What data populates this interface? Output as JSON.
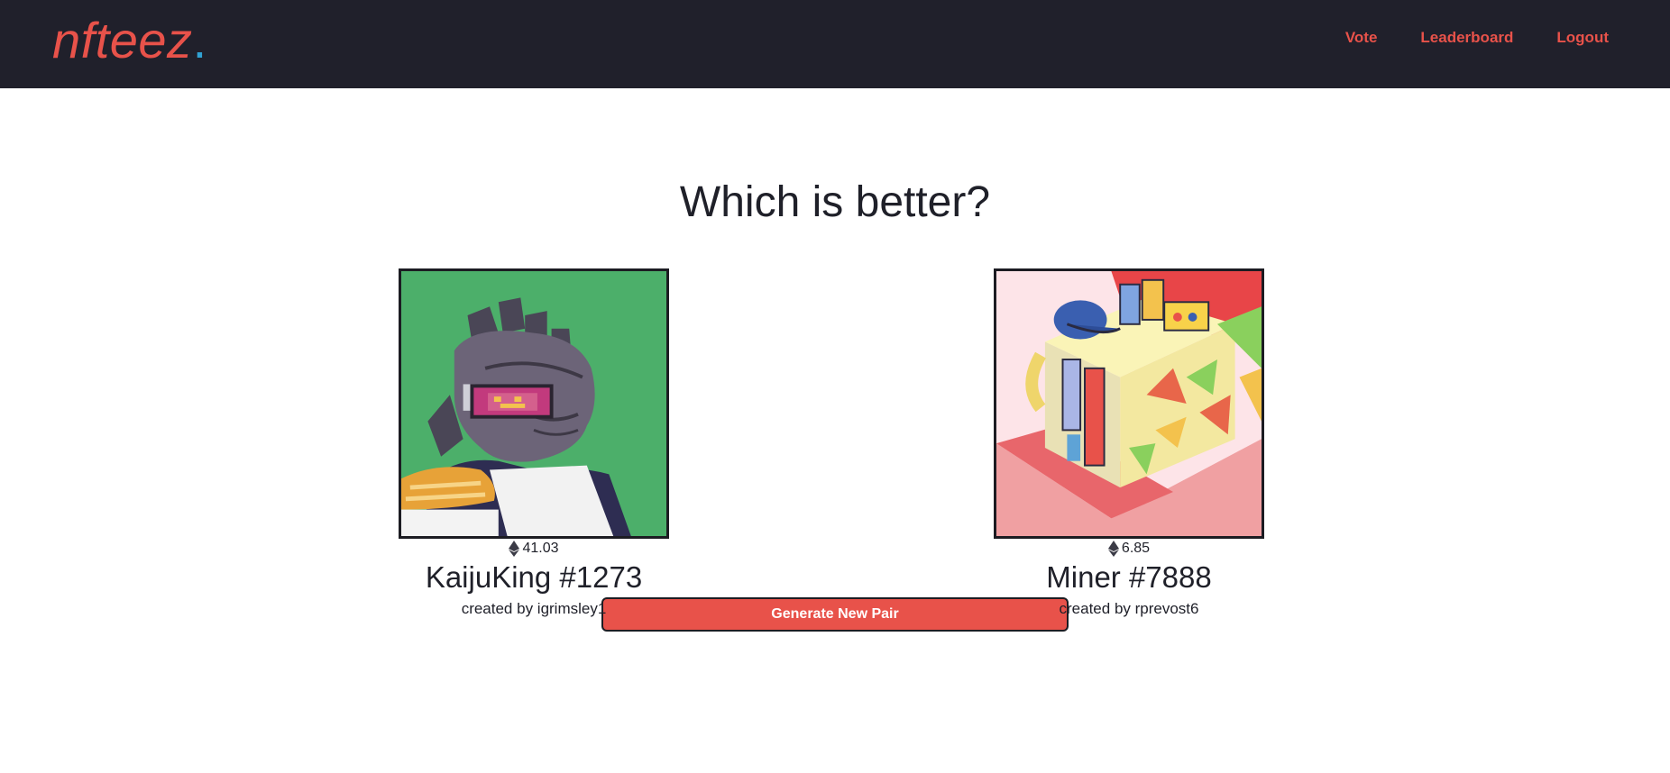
{
  "header": {
    "logo_text": "nfteez",
    "logo_dot": ".",
    "nav": [
      {
        "label": "Vote"
      },
      {
        "label": "Leaderboard"
      },
      {
        "label": "Logout"
      }
    ]
  },
  "main": {
    "title": "Which is better?",
    "items": [
      {
        "price": "41.03",
        "name": "KaijuKing #1273",
        "creator": "created by igrimsley1",
        "image_icon": "pixel-art-kaiju-image"
      },
      {
        "price": "6.85",
        "name": "Miner #7888",
        "creator": "created by rprevost6",
        "image_icon": "isometric-miner-image"
      }
    ],
    "generate_label": "Generate New Pair"
  },
  "colors": {
    "nav_bg": "#20202b",
    "accent": "#e8524a",
    "logo_dot": "#31a2d3"
  }
}
